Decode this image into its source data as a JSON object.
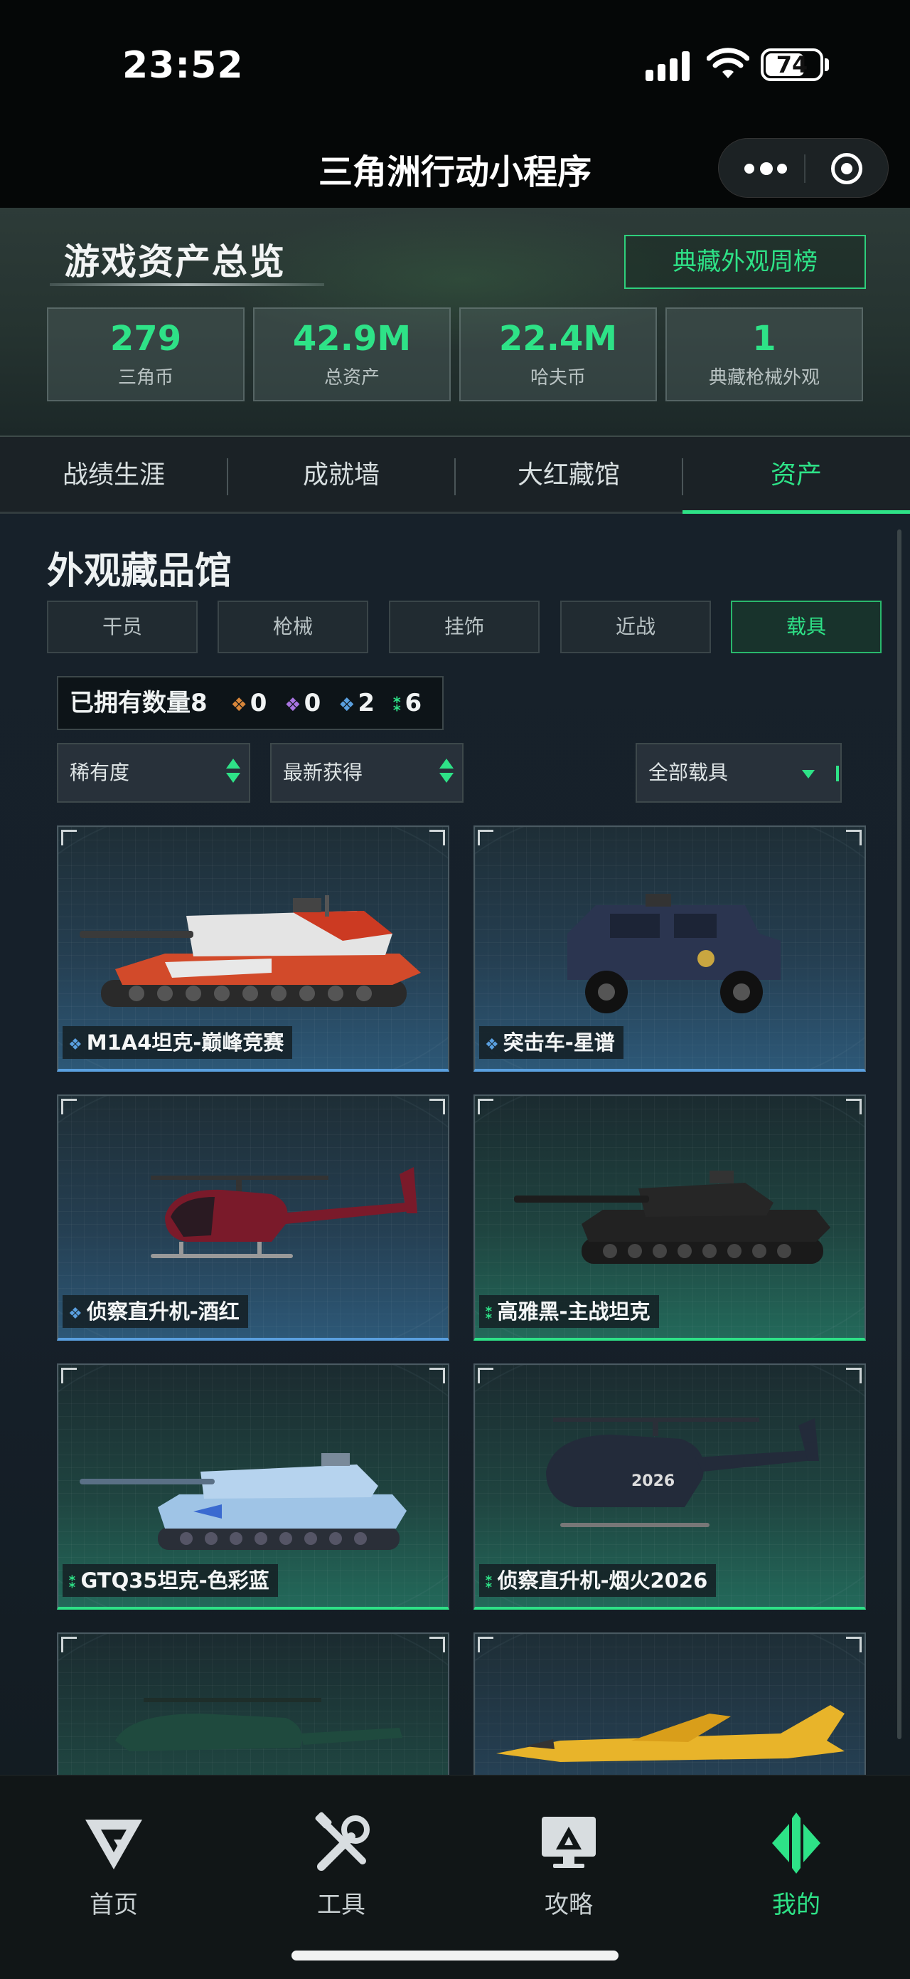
{
  "status_bar": {
    "time": "23:52",
    "battery": "74"
  },
  "mini_program": {
    "title": "三角洲行动小程序"
  },
  "overview": {
    "title": "游戏资产总览",
    "weekly_button": "典藏外观周榜",
    "stats": [
      {
        "value": "279",
        "label": "三角币"
      },
      {
        "value": "42.9M",
        "label": "总资产"
      },
      {
        "value": "22.4M",
        "label": "哈夫币"
      },
      {
        "value": "1",
        "label": "典藏枪械外观"
      }
    ]
  },
  "main_tabs": [
    {
      "label": "战绩生涯"
    },
    {
      "label": "成就墙"
    },
    {
      "label": "大红藏馆"
    },
    {
      "label": "资产",
      "active": true
    }
  ],
  "collection": {
    "title": "外观藏品馆",
    "categories": [
      {
        "label": "干员"
      },
      {
        "label": "枪械"
      },
      {
        "label": "挂饰"
      },
      {
        "label": "近战"
      },
      {
        "label": "载具",
        "active": true
      }
    ],
    "owned": {
      "label": "已拥有数量8",
      "rarities": [
        {
          "count": "0",
          "color": "#d8863a"
        },
        {
          "count": "0",
          "color": "#a874e0"
        },
        {
          "count": "2",
          "color": "#5aa0e0"
        },
        {
          "count": "6",
          "color": "#2ee287"
        }
      ]
    },
    "filters": {
      "rarity": "稀有度",
      "sort": "最新获得",
      "scope": "全部载具"
    },
    "items": [
      {
        "name": "M1A4坦克-巅峰竞赛",
        "rarity": "blue",
        "icon": "tank-icon"
      },
      {
        "name": "突击车-星谱",
        "rarity": "blue",
        "icon": "armored-car-icon"
      },
      {
        "name": "侦察直升机-酒红",
        "rarity": "blue",
        "icon": "helicopter-icon"
      },
      {
        "name": "高雅黑-主战坦克",
        "rarity": "green",
        "icon": "tank-icon"
      },
      {
        "name": "GTQ35坦克-色彩蓝",
        "rarity": "green",
        "icon": "tank-icon"
      },
      {
        "name": "侦察直升机-烟火2026",
        "rarity": "green",
        "icon": "helicopter-icon"
      },
      {
        "name": "",
        "rarity": "none",
        "icon": "attack-helicopter-icon"
      },
      {
        "name": "",
        "rarity": "none",
        "icon": "jet-icon"
      }
    ]
  },
  "bottom_nav": [
    {
      "label": "首页",
      "icon": "home-icon"
    },
    {
      "label": "工具",
      "icon": "tools-icon"
    },
    {
      "label": "攻略",
      "icon": "guide-icon"
    },
    {
      "label": "我的",
      "icon": "profile-icon",
      "active": true
    }
  ]
}
